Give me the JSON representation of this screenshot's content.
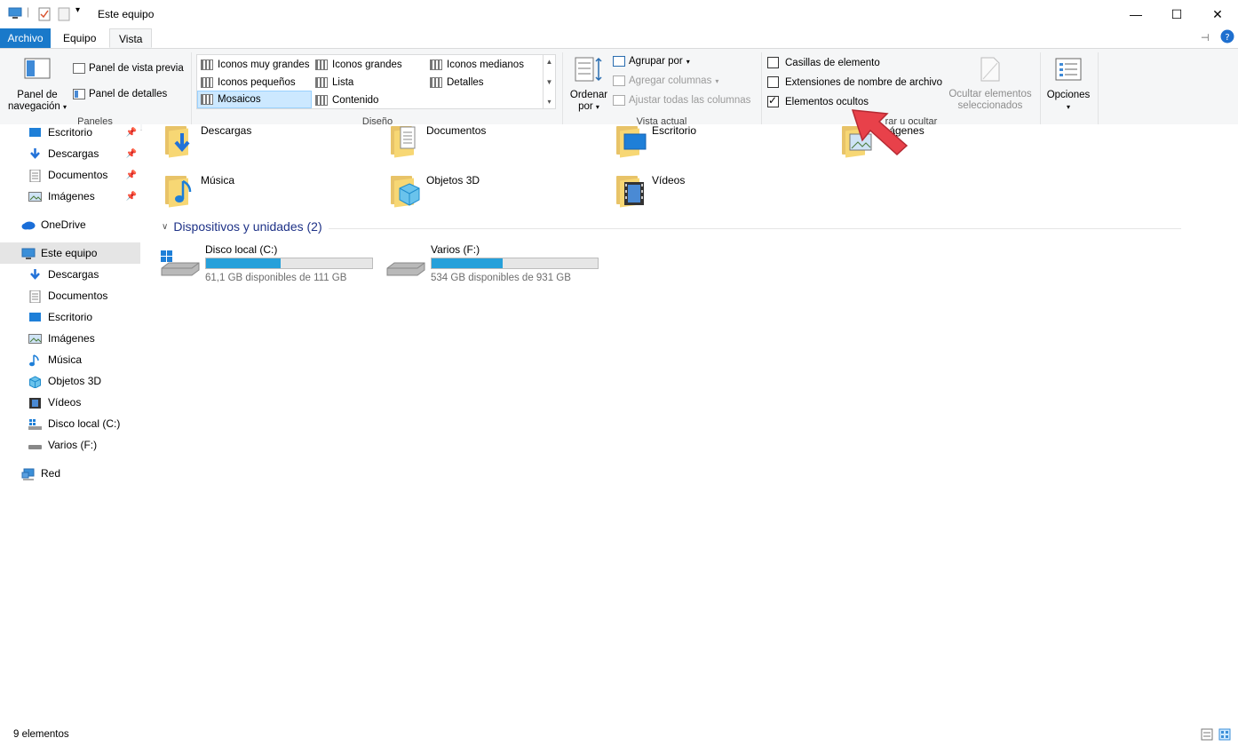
{
  "window": {
    "title": "Este equipo",
    "controls": {
      "minimize": "—",
      "maximize": "☐",
      "close": "✕"
    }
  },
  "tabs": [
    {
      "label": "Archivo",
      "name": "tab-archivo"
    },
    {
      "label": "Equipo",
      "name": "tab-equipo"
    },
    {
      "label": "Vista",
      "name": "tab-vista",
      "active": true
    }
  ],
  "ribbon": {
    "panes": {
      "nav_pane_line1": "Panel de",
      "nav_pane_line2": "navegación",
      "preview_pane": "Panel de vista previa",
      "details_pane": "Panel de detalles",
      "group_label": "Paneles"
    },
    "layout": {
      "items": [
        "Iconos muy grandes",
        "Iconos grandes",
        "Iconos medianos",
        "Iconos pequeños",
        "Lista",
        "Detalles",
        "Mosaicos",
        "Contenido"
      ],
      "selected": "Mosaicos",
      "group_label": "Diseño"
    },
    "current_view": {
      "sort_line1": "Ordenar",
      "sort_line2": "por",
      "group_by": "Agrupar por",
      "add_columns": "Agregar columnas",
      "fit_columns": "Ajustar todas las columnas",
      "group_label": "Vista actual"
    },
    "show_hide": {
      "item_checkboxes": "Casillas de elemento",
      "file_extensions": "Extensiones de nombre de archivo",
      "hidden_items": "Elementos ocultos",
      "hide_selected_line1": "Ocultar elementos",
      "hide_selected_line2": "seleccionados",
      "group_label": "rar u ocultar"
    },
    "options": "Opciones"
  },
  "nav_pane": {
    "quick_access": [
      {
        "label": "Escritorio",
        "pinned": true
      },
      {
        "label": "Descargas",
        "pinned": true
      },
      {
        "label": "Documentos",
        "pinned": true
      },
      {
        "label": "Imágenes",
        "pinned": true
      }
    ],
    "onedrive": "OneDrive",
    "this_pc": "Este equipo",
    "this_pc_children": [
      "Descargas",
      "Documentos",
      "Escritorio",
      "Imágenes",
      "Música",
      "Objetos 3D",
      "Vídeos",
      "Disco local (C:)",
      "Varios (F:)"
    ],
    "network": "Red"
  },
  "content": {
    "folders_row1": [
      "Descargas",
      "Documentos",
      "Escritorio",
      "Imágenes"
    ],
    "folders_row2": [
      "Música",
      "Objetos 3D",
      "Vídeos"
    ],
    "devices_section": "Dispositivos y unidades (2)",
    "drives": [
      {
        "name": "Disco local (C:)",
        "free": "61,1 GB disponibles de 111 GB",
        "used_fraction": 0.45
      },
      {
        "name": "Varios (F:)",
        "free": "534 GB disponibles de 931 GB",
        "used_fraction": 0.43
      }
    ]
  },
  "status": {
    "count": "9 elementos"
  },
  "colors": {
    "accent": "#1979ca",
    "drive_bar": "#26a0da",
    "pointer": "#e8414a"
  }
}
